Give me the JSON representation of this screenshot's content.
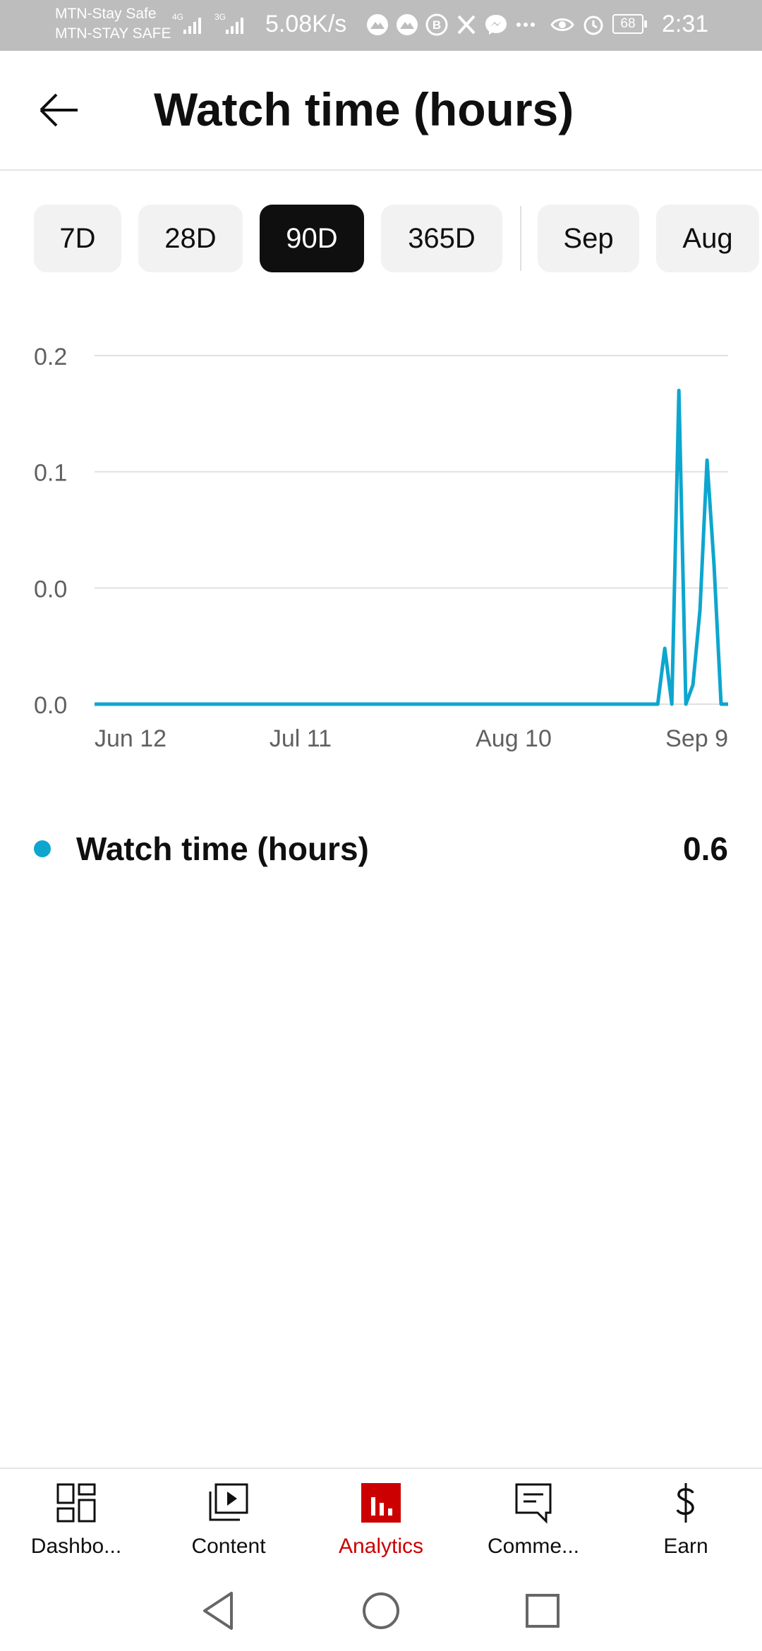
{
  "status_bar": {
    "carrier_1": "MTN-Stay Safe",
    "carrier_2": "MTN-STAY SAFE",
    "net_1": "4G",
    "net_2": "3G",
    "speed": "5.08K/s",
    "battery": "68",
    "time": "2:31",
    "icons": [
      "signal-icon",
      "signal-icon",
      "mountain-app-icon",
      "mountain-app-icon",
      "b-app-icon",
      "x-icon",
      "messenger-icon",
      "more-icon",
      "eye-icon",
      "alarm-icon",
      "battery-icon"
    ]
  },
  "header": {
    "title": "Watch time (hours)",
    "back_icon": "back-arrow-icon"
  },
  "chips": [
    {
      "label": "7D",
      "selected": false
    },
    {
      "label": "28D",
      "selected": false
    },
    {
      "label": "90D",
      "selected": true
    },
    {
      "label": "365D",
      "selected": false
    },
    {
      "label": "Sep",
      "selected": false
    },
    {
      "label": "Aug",
      "selected": false
    }
  ],
  "chart_data": {
    "type": "line",
    "title": "",
    "xlabel": "",
    "ylabel": "",
    "x_ticks": [
      "Jun 12",
      "Jul 11",
      "Aug 10",
      "Sep 9"
    ],
    "y_ticks": [
      "0.0",
      "0.0",
      "0.1",
      "0.2"
    ],
    "ylim": [
      0,
      0.2
    ],
    "grid": true,
    "series": [
      {
        "name": "Watch time (hours)",
        "color": "#0da6cf",
        "values": [
          0,
          0,
          0,
          0,
          0,
          0,
          0,
          0,
          0,
          0,
          0,
          0,
          0,
          0,
          0,
          0,
          0,
          0,
          0,
          0,
          0,
          0,
          0,
          0,
          0,
          0,
          0,
          0,
          0,
          0,
          0,
          0,
          0,
          0,
          0,
          0,
          0,
          0,
          0,
          0,
          0,
          0,
          0,
          0,
          0,
          0,
          0,
          0,
          0,
          0,
          0,
          0,
          0,
          0,
          0,
          0,
          0,
          0,
          0,
          0,
          0,
          0,
          0,
          0,
          0,
          0,
          0,
          0,
          0,
          0,
          0,
          0,
          0,
          0,
          0,
          0,
          0,
          0,
          0,
          0,
          0,
          0.032,
          0,
          0.18,
          0,
          0.011,
          0.054,
          0.14,
          0.08,
          0,
          0
        ]
      }
    ]
  },
  "legend": {
    "label": "Watch time (hours)",
    "value": "0.6",
    "color": "#0da6cf"
  },
  "bottom_nav": [
    {
      "label": "Dashbo...",
      "icon": "dashboard-icon",
      "active": false
    },
    {
      "label": "Content",
      "icon": "content-icon",
      "active": false
    },
    {
      "label": "Analytics",
      "icon": "analytics-icon",
      "active": true
    },
    {
      "label": "Comme...",
      "icon": "comments-icon",
      "active": false
    },
    {
      "label": "Earn",
      "icon": "earn-icon",
      "active": false
    }
  ],
  "system_nav": {
    "back": "back-triangle-icon",
    "home": "home-circle-icon",
    "recents": "recents-square-icon"
  },
  "colors": {
    "accent": "#cc0000",
    "series": "#0da6cf",
    "chip_selected": "#0f0f0f"
  }
}
